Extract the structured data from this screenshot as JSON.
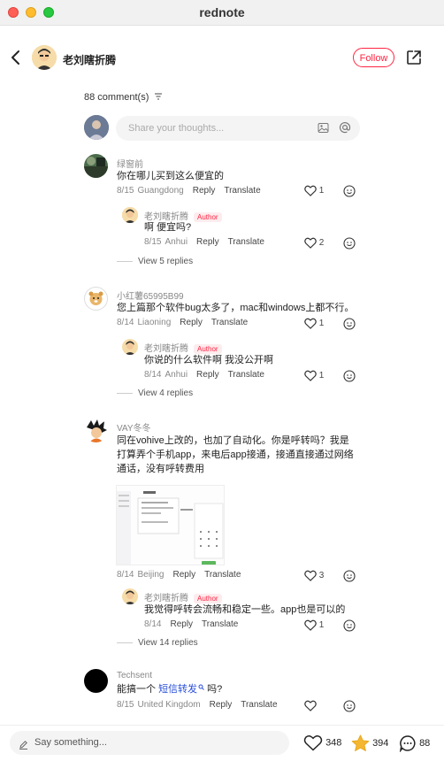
{
  "window": {
    "title": "rednote"
  },
  "header": {
    "author_name": "老刘瞎折腾",
    "follow_label": "Follow"
  },
  "comments_count": "88 comment(s)",
  "compose": {
    "placeholder": "Share your thoughts..."
  },
  "comments": [
    {
      "user": "绿窗前",
      "text": "你在哪儿买到这么便宜的",
      "date": "8/15",
      "location": "Guangdong",
      "reply_label": "Reply",
      "translate_label": "Translate",
      "likes": "1",
      "reply": {
        "user": "老刘瞎折腾",
        "badge": "Author",
        "text": "啊 便宜吗?",
        "date": "8/15",
        "location": "Anhui",
        "likes": "2"
      },
      "view_replies": "View 5 replies"
    },
    {
      "user": "小红薯65995B99",
      "text": "您上篇那个软件bug太多了，mac和windows上都不行。",
      "date": "8/14",
      "location": "Liaoning",
      "reply_label": "Reply",
      "translate_label": "Translate",
      "likes": "1",
      "reply": {
        "user": "老刘瞎折腾",
        "badge": "Author",
        "text": "你说的什么软件啊 我没公开啊",
        "date": "8/14",
        "location": "Anhui",
        "likes": "1"
      },
      "view_replies": "View 4 replies"
    },
    {
      "user": "VAY冬冬",
      "text_lines": [
        "同在vohive上改的，也加了自动化。你是呼转吗？我是",
        "打算弄个手机app，来电后app接通，接通直接通过网络",
        "通话，没有呼转费用"
      ],
      "date": "8/14",
      "location": "Beijing",
      "reply_label": "Reply",
      "translate_label": "Translate",
      "likes": "3",
      "reply": {
        "user": "老刘瞎折腾",
        "badge": "Author",
        "text": "我觉得呼转会流畅和稳定一些。app也是可以的",
        "date": "8/14",
        "location": "",
        "likes": "1"
      },
      "view_replies": "View 14 replies"
    },
    {
      "user": "Techsent",
      "text_prefix": "能搞一个",
      "link_text": "短信转发",
      "text_suffix": "吗?",
      "date": "8/15",
      "location": "United Kingdom",
      "reply_label": "Reply",
      "translate_label": "Translate",
      "likes": ""
    }
  ],
  "bottom": {
    "say_placeholder": "Say something...",
    "likes": "348",
    "stars": "394",
    "comments": "88"
  },
  "colors": {
    "accent": "#ff2442",
    "star": "#f5b731",
    "link": "#2a4fd8"
  }
}
